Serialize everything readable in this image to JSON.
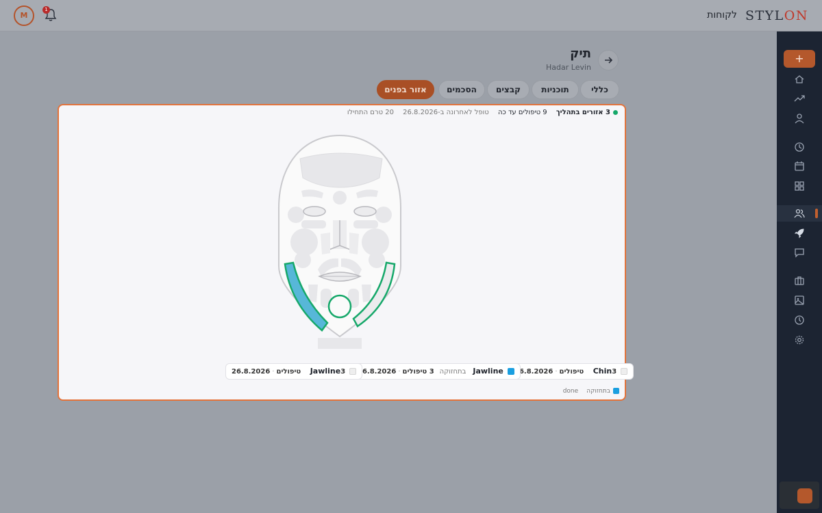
{
  "brand": {
    "prefix": "STYL",
    "accent": "ON"
  },
  "topbar": {
    "nav_title": "לקוחות",
    "avatar_initial": "M",
    "notification_count": "1"
  },
  "page": {
    "title": "תיק",
    "client_name": "Hadar Levin"
  },
  "tabs": [
    {
      "label": "כללי",
      "active": false
    },
    {
      "label": "תוכניות",
      "active": false
    },
    {
      "label": "קבצים",
      "active": false
    },
    {
      "label": "הסכמים",
      "active": false
    },
    {
      "label": "אזור בפנים",
      "active": true
    }
  ],
  "summary": {
    "zones_in_progress": "3 אזורים בתהליך",
    "treatments_so_far": "9 טיפולים עד כה",
    "last_treated": "טופל לאחרונה ב-26.8.2026",
    "not_started": "20 טרם התחילו"
  },
  "zones": [
    {
      "name": "Chin",
      "status": "",
      "count": "3 טיפולים",
      "date": "26.8.2026",
      "checked": false
    },
    {
      "name": "Jawline",
      "status": "בתחזוקה",
      "count": "3 טיפולים",
      "date": "26.8.2026",
      "checked": true
    },
    {
      "name": "Jawline",
      "status": "",
      "count": "3 טיפולים",
      "date": "26.8.2026",
      "checked": false
    }
  ],
  "legend": {
    "maintenance": "בתחזוקה",
    "done": "done"
  },
  "colors": {
    "accent": "#e3723a",
    "brand_accent": "#c0392b",
    "maintenance_blue": "#1a9fe0",
    "in_progress_green": "#16a86a",
    "sidebar_bg": "#1c2432"
  },
  "sidebar_icons": [
    "plus-icon",
    "home-icon",
    "trending-icon",
    "user-icon",
    "clock-icon",
    "calendar-icon",
    "grid-icon",
    "users-icon",
    "rocket-icon",
    "chat-icon",
    "briefcase-icon",
    "image-icon",
    "history-icon",
    "settings-icon"
  ]
}
